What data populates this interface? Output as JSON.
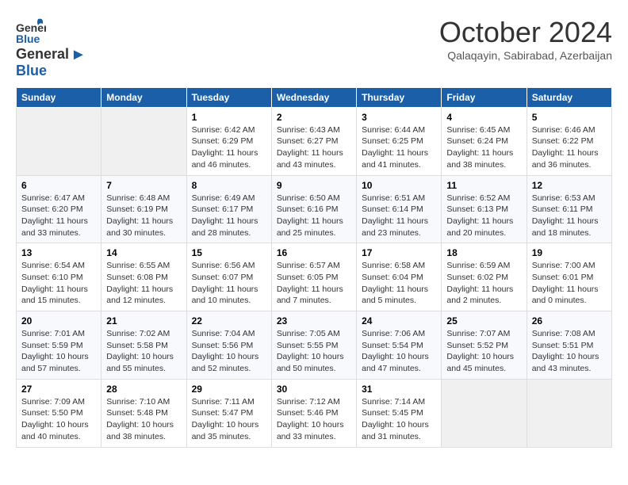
{
  "logo": {
    "general": "General",
    "blue": "Blue"
  },
  "header": {
    "month": "October 2024",
    "location": "Qalaqayin, Sabirabad, Azerbaijan"
  },
  "weekdays": [
    "Sunday",
    "Monday",
    "Tuesday",
    "Wednesday",
    "Thursday",
    "Friday",
    "Saturday"
  ],
  "weeks": [
    [
      {
        "day": "",
        "info": ""
      },
      {
        "day": "",
        "info": ""
      },
      {
        "day": "1",
        "info": "Sunrise: 6:42 AM\nSunset: 6:29 PM\nDaylight: 11 hours and 46 minutes."
      },
      {
        "day": "2",
        "info": "Sunrise: 6:43 AM\nSunset: 6:27 PM\nDaylight: 11 hours and 43 minutes."
      },
      {
        "day": "3",
        "info": "Sunrise: 6:44 AM\nSunset: 6:25 PM\nDaylight: 11 hours and 41 minutes."
      },
      {
        "day": "4",
        "info": "Sunrise: 6:45 AM\nSunset: 6:24 PM\nDaylight: 11 hours and 38 minutes."
      },
      {
        "day": "5",
        "info": "Sunrise: 6:46 AM\nSunset: 6:22 PM\nDaylight: 11 hours and 36 minutes."
      }
    ],
    [
      {
        "day": "6",
        "info": "Sunrise: 6:47 AM\nSunset: 6:20 PM\nDaylight: 11 hours and 33 minutes."
      },
      {
        "day": "7",
        "info": "Sunrise: 6:48 AM\nSunset: 6:19 PM\nDaylight: 11 hours and 30 minutes."
      },
      {
        "day": "8",
        "info": "Sunrise: 6:49 AM\nSunset: 6:17 PM\nDaylight: 11 hours and 28 minutes."
      },
      {
        "day": "9",
        "info": "Sunrise: 6:50 AM\nSunset: 6:16 PM\nDaylight: 11 hours and 25 minutes."
      },
      {
        "day": "10",
        "info": "Sunrise: 6:51 AM\nSunset: 6:14 PM\nDaylight: 11 hours and 23 minutes."
      },
      {
        "day": "11",
        "info": "Sunrise: 6:52 AM\nSunset: 6:13 PM\nDaylight: 11 hours and 20 minutes."
      },
      {
        "day": "12",
        "info": "Sunrise: 6:53 AM\nSunset: 6:11 PM\nDaylight: 11 hours and 18 minutes."
      }
    ],
    [
      {
        "day": "13",
        "info": "Sunrise: 6:54 AM\nSunset: 6:10 PM\nDaylight: 11 hours and 15 minutes."
      },
      {
        "day": "14",
        "info": "Sunrise: 6:55 AM\nSunset: 6:08 PM\nDaylight: 11 hours and 12 minutes."
      },
      {
        "day": "15",
        "info": "Sunrise: 6:56 AM\nSunset: 6:07 PM\nDaylight: 11 hours and 10 minutes."
      },
      {
        "day": "16",
        "info": "Sunrise: 6:57 AM\nSunset: 6:05 PM\nDaylight: 11 hours and 7 minutes."
      },
      {
        "day": "17",
        "info": "Sunrise: 6:58 AM\nSunset: 6:04 PM\nDaylight: 11 hours and 5 minutes."
      },
      {
        "day": "18",
        "info": "Sunrise: 6:59 AM\nSunset: 6:02 PM\nDaylight: 11 hours and 2 minutes."
      },
      {
        "day": "19",
        "info": "Sunrise: 7:00 AM\nSunset: 6:01 PM\nDaylight: 11 hours and 0 minutes."
      }
    ],
    [
      {
        "day": "20",
        "info": "Sunrise: 7:01 AM\nSunset: 5:59 PM\nDaylight: 10 hours and 57 minutes."
      },
      {
        "day": "21",
        "info": "Sunrise: 7:02 AM\nSunset: 5:58 PM\nDaylight: 10 hours and 55 minutes."
      },
      {
        "day": "22",
        "info": "Sunrise: 7:04 AM\nSunset: 5:56 PM\nDaylight: 10 hours and 52 minutes."
      },
      {
        "day": "23",
        "info": "Sunrise: 7:05 AM\nSunset: 5:55 PM\nDaylight: 10 hours and 50 minutes."
      },
      {
        "day": "24",
        "info": "Sunrise: 7:06 AM\nSunset: 5:54 PM\nDaylight: 10 hours and 47 minutes."
      },
      {
        "day": "25",
        "info": "Sunrise: 7:07 AM\nSunset: 5:52 PM\nDaylight: 10 hours and 45 minutes."
      },
      {
        "day": "26",
        "info": "Sunrise: 7:08 AM\nSunset: 5:51 PM\nDaylight: 10 hours and 43 minutes."
      }
    ],
    [
      {
        "day": "27",
        "info": "Sunrise: 7:09 AM\nSunset: 5:50 PM\nDaylight: 10 hours and 40 minutes."
      },
      {
        "day": "28",
        "info": "Sunrise: 7:10 AM\nSunset: 5:48 PM\nDaylight: 10 hours and 38 minutes."
      },
      {
        "day": "29",
        "info": "Sunrise: 7:11 AM\nSunset: 5:47 PM\nDaylight: 10 hours and 35 minutes."
      },
      {
        "day": "30",
        "info": "Sunrise: 7:12 AM\nSunset: 5:46 PM\nDaylight: 10 hours and 33 minutes."
      },
      {
        "day": "31",
        "info": "Sunrise: 7:14 AM\nSunset: 5:45 PM\nDaylight: 10 hours and 31 minutes."
      },
      {
        "day": "",
        "info": ""
      },
      {
        "day": "",
        "info": ""
      }
    ]
  ]
}
